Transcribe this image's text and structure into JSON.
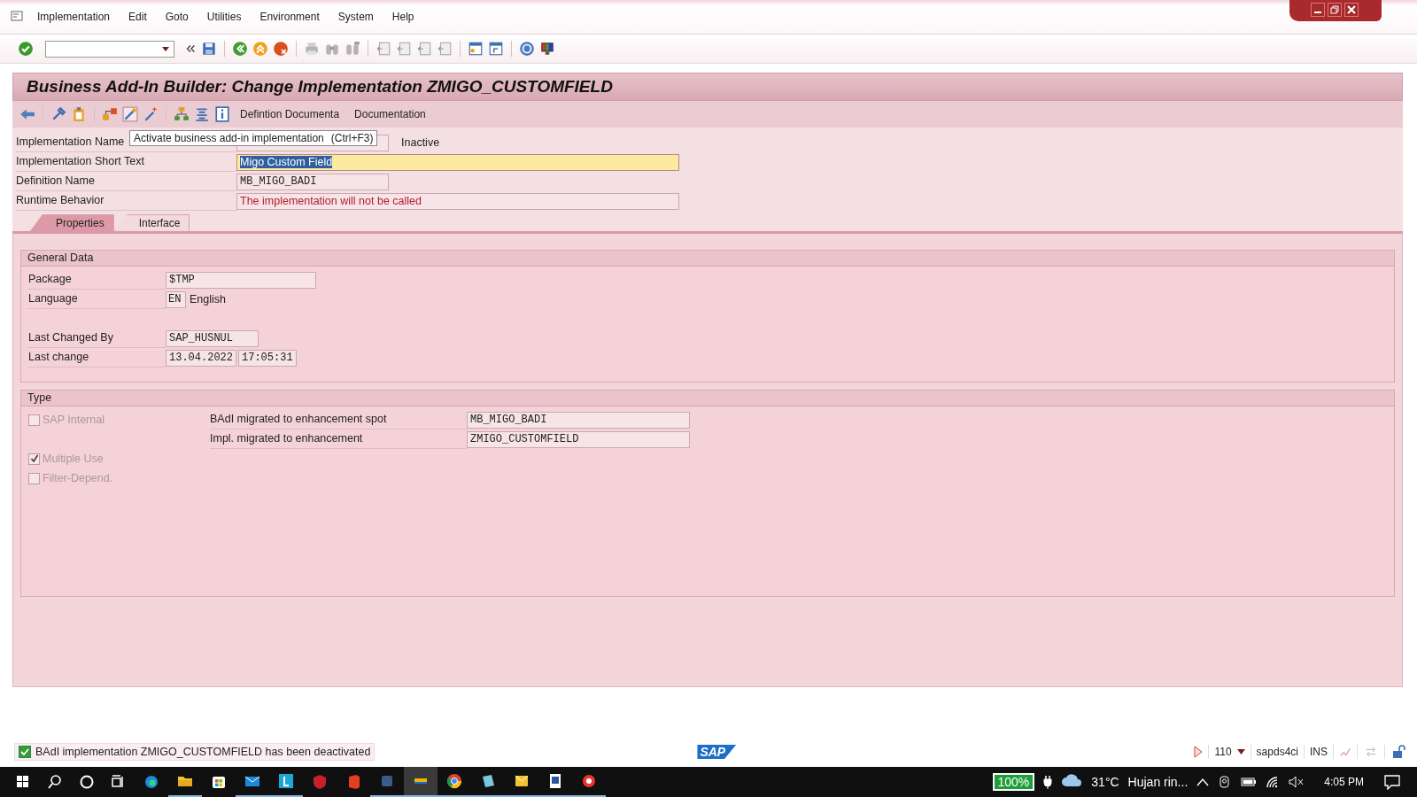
{
  "menu": [
    "Implementation",
    "Edit",
    "Goto",
    "Utilities",
    "Environment",
    "System",
    "Help"
  ],
  "title": "Business Add-In Builder: Change Implementation ZMIGO_CUSTOMFIELD",
  "app_toolbar": {
    "buttons": [
      "Defintion Documenta",
      "Documentation"
    ]
  },
  "tooltip": {
    "text": "Activate business add-in implementation",
    "shortcut": "(Ctrl+F3)"
  },
  "header_fields": [
    {
      "label": "Implementation Name",
      "kind": "hidden",
      "status": "Inactive"
    },
    {
      "label": "Implementation Short Text",
      "kind": "focused",
      "value": "Migo Custom Field"
    },
    {
      "label": "Definition Name",
      "kind": "code",
      "value": "MB_MIGO_BADI"
    },
    {
      "label": "Runtime Behavior",
      "kind": "message",
      "value": "The implementation will not be called"
    }
  ],
  "tabs": [
    {
      "label": "Properties",
      "selected": true
    },
    {
      "label": "Interface",
      "selected": false
    }
  ],
  "general_data": {
    "title": "General Data",
    "package": {
      "label": "Package",
      "value": "$TMP"
    },
    "language": {
      "label": "Language",
      "code": "EN",
      "name": "English"
    },
    "last_changed_by": {
      "label": "Last Changed By",
      "value": "SAP_HUSNUL"
    },
    "last_change": {
      "label": "Last change",
      "date": "13.04.2022",
      "time": "17:05:31"
    }
  },
  "type": {
    "title": "Type",
    "checkboxes": [
      {
        "label": "SAP Internal",
        "checked": false,
        "disabled": true
      },
      {
        "label": "Multiple Use",
        "checked": true,
        "disabled": true
      },
      {
        "label": "Filter-Depend.",
        "checked": false,
        "disabled": true
      }
    ],
    "fields": [
      {
        "label": "BAdI migrated to enhancement spot",
        "value": "MB_MIGO_BADI"
      },
      {
        "label": "Impl. migrated to enhancement",
        "value": "ZMIGO_CUSTOMFIELD"
      }
    ]
  },
  "status_bar": {
    "message": "BAdI implementation ZMIGO_CUSTOMFIELD has been deactivated",
    "logo": "SAP",
    "client": "110",
    "server": "sapds4ci",
    "mode": "INS"
  },
  "taskbar": {
    "apps": [
      {
        "running": false,
        "selected": false
      },
      {
        "running": true,
        "selected": false
      },
      {
        "running": false,
        "selected": false
      },
      {
        "running": true,
        "selected": false
      },
      {
        "running": true,
        "selected": false
      },
      {
        "running": false,
        "selected": false
      },
      {
        "running": false,
        "selected": false
      },
      {
        "running": true,
        "selected": false
      },
      {
        "running": true,
        "selected": true
      },
      {
        "running": true,
        "selected": false
      },
      {
        "running": true,
        "selected": false
      },
      {
        "running": true,
        "selected": false
      },
      {
        "running": true,
        "selected": false
      },
      {
        "running": true,
        "selected": false
      }
    ],
    "battery": "100%",
    "temperature": "31°C",
    "weather": "Hujan rin...",
    "time": "4:05 PM"
  }
}
